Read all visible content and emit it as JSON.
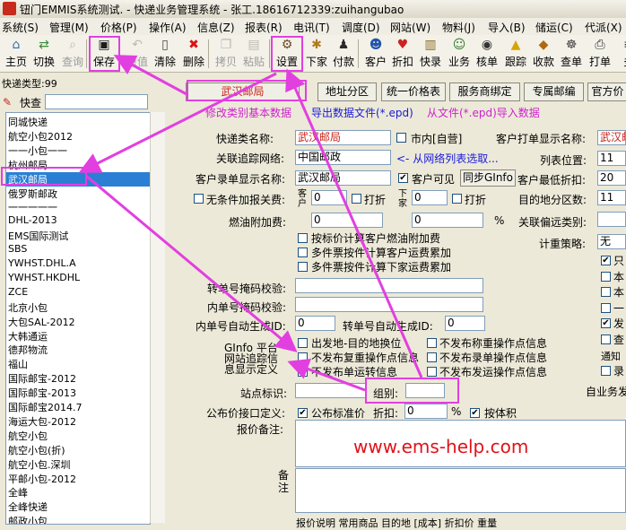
{
  "window": {
    "title": "钮门EMMIS系统测试. - 快递业务管理系统 - 张工.18616712339:zuihangubao"
  },
  "menu": [
    "系统(S)",
    "管理(M)",
    "价格(P)",
    "操作(A)",
    "信息(Z)",
    "报表(R)",
    "电讯(T)",
    "调度(D)",
    "网站(W)",
    "物料(J)",
    "导入(B)",
    "储运(C)",
    "代派(X)"
  ],
  "toolbar": [
    {
      "label": "主页",
      "icon": "home-icon",
      "glyph": "⌂",
      "color": "#2f6db5",
      "enabled": true
    },
    {
      "label": "切换",
      "icon": "switch-icon",
      "glyph": "⇄",
      "color": "#3c8a3c",
      "enabled": true
    },
    {
      "label": "查询",
      "icon": "query-icon",
      "glyph": "⌕",
      "color": "#777",
      "enabled": false
    },
    {
      "label": "保存",
      "icon": "save-icon",
      "glyph": "▣",
      "color": "#1c1c1c",
      "enabled": true
    },
    {
      "label": "原值",
      "icon": "restore-icon",
      "glyph": "↶",
      "color": "#777",
      "enabled": false
    },
    {
      "label": "清除",
      "icon": "clear-icon",
      "glyph": "▯",
      "color": "#444",
      "enabled": true
    },
    {
      "label": "删除",
      "icon": "delete-icon",
      "glyph": "✖",
      "color": "#d11",
      "enabled": true
    },
    {
      "label": "拷贝",
      "icon": "copy-icon",
      "glyph": "❐",
      "color": "#777",
      "enabled": false
    },
    {
      "label": "粘贴",
      "icon": "paste-icon",
      "glyph": "▤",
      "color": "#777",
      "enabled": false
    },
    {
      "label": "设置",
      "icon": "settings-icon",
      "glyph": "⚙",
      "color": "#6a4b2a",
      "enabled": true
    },
    {
      "label": "下家",
      "icon": "downstream-icon",
      "glyph": "✱",
      "color": "#b07a18",
      "enabled": true
    },
    {
      "label": "付款",
      "icon": "payment-icon",
      "glyph": "♟",
      "color": "#2a2a2a",
      "enabled": true
    },
    {
      "label": "客户",
      "icon": "customer-icon",
      "glyph": "☻",
      "color": "#2255aa",
      "enabled": true
    },
    {
      "label": "折扣",
      "icon": "discount-icon",
      "glyph": "♥",
      "color": "#cc2222",
      "enabled": true
    },
    {
      "label": "快录",
      "icon": "quick-entry-icon",
      "glyph": "▥",
      "color": "#8a6a20",
      "enabled": true
    },
    {
      "label": "业务",
      "icon": "business-icon",
      "glyph": "☺",
      "color": "#2a7a2a",
      "enabled": true
    },
    {
      "label": "核单",
      "icon": "check-order-icon",
      "glyph": "◉",
      "color": "#333",
      "enabled": true
    },
    {
      "label": "跟踪",
      "icon": "tracking-icon",
      "glyph": "▲",
      "color": "#d6a400",
      "enabled": true
    },
    {
      "label": "收款",
      "icon": "receive-icon",
      "glyph": "◆",
      "color": "#b06a10",
      "enabled": true
    },
    {
      "label": "查单",
      "icon": "search-order-icon",
      "glyph": "☸",
      "color": "#444",
      "enabled": true
    },
    {
      "label": "打单",
      "icon": "print-icon",
      "glyph": "⎙",
      "color": "#333",
      "enabled": true
    },
    {
      "label": "多",
      "icon": "more-icon",
      "glyph": "≡",
      "color": "#333",
      "enabled": true
    }
  ],
  "left": {
    "type_label": "快递类型:99",
    "search_label": "快查",
    "search_value": "",
    "items": [
      "同城快递",
      "航空小包2012",
      "一一小包一一",
      "杭州邮局",
      "武汉邮局",
      "俄罗斯邮政",
      "一一一一一",
      "DHL-2013",
      "EMS国际测试",
      "SBS",
      "YWHST.DHL.A",
      "YWHST.HKDHL",
      "ZCE",
      "北京小包",
      "大包SAL-2012",
      "大韩通运",
      "德邦物流",
      "福山",
      "国际邮宝-2012",
      "国际邮宝-2013",
      "国际邮宝2014.7",
      "海运大包-2012",
      "航空小包",
      "航空小包(折)",
      "航空小包.深圳",
      "平邮小包-2012",
      "全峰",
      "全峰快递",
      "邮政小包"
    ]
  },
  "tabs": [
    "武汉邮局",
    "地址分区",
    "统一价格表",
    "服务商绑定",
    "专属邮编",
    "官方价"
  ],
  "links": {
    "modify_basic": "修改类别基本数据",
    "export": "导出数据文件(*.epd)",
    "import": "从文件(*.epd)导入数据"
  },
  "form": {
    "type_name_label": "快递类名称:",
    "type_name_value": "武汉邮局",
    "city_label": "市内[自营]",
    "track_label": "关联追踪网络:",
    "track_value": "中国邮政",
    "track_hint": "<- 从网络列表选取...",
    "display_label": "客户录单显示名称:",
    "display_value": "武汉邮局",
    "visible_label": "客户可见",
    "sync_label": "同步GInfo",
    "no_extra_label": "无条件加报关费:",
    "customer_vert": "客户",
    "downstream_vert": "下家",
    "extra1": "0",
    "extra2": "0",
    "discount_label": "打折",
    "fuel_label": "燃油附加费:",
    "fuel_c": "0",
    "fuel_d": "0",
    "percent": "%",
    "opt1": "按标价计算客户燃油附加费",
    "opt2": "多件票按件计算客户运费累加",
    "opt3": "多件票按件计算下家运费累加",
    "waybill_mask_label": "转单号掩码校验:",
    "inner_mask_label": "内单号掩码校验:",
    "auto_id_label": "内单号自动生成ID:",
    "auto_id_value": "0",
    "trans_id_label": "转单号自动生成ID:",
    "trans_id_value": "0",
    "ginfo_platform": "GInfo 平台",
    "site_tracking": "网站追踪信",
    "info_defined": "息显示定义",
    "o1": "出发地-目的地换位",
    "o2": "不发布称重操作点信息",
    "o3": "不发布复重操作点信息",
    "o4": "不发布录单操作点信息",
    "o5": "不发布单运转信息",
    "o6": "不发布发运操作点信息",
    "station_label": "站点标识:",
    "group_label": "组别:",
    "public_label": "公布价接口定义:",
    "public_std": "公布标准价",
    "discount2_label": "折扣:",
    "discount2_value": "0",
    "volume_label": "按体积",
    "remark_label": "报价备注:",
    "note_label": "备注",
    "bottom_text": "报价说明  常用商品  目的地 [成本]  折扣价  重量"
  },
  "right": {
    "print_name_label": "客户打单显示名称:",
    "print_name_value": "武汉邮",
    "list_pos_label": "列表位置:",
    "list_pos_value": "11",
    "min_disc_label": "客户最低折扣:",
    "min_disc_value": "20",
    "zone_count_label": "目的地分区数:",
    "zone_count_value": "11",
    "pref_label": "关联偏远类别:",
    "weight_policy_label": "计重策略:",
    "weight_policy_value": "无",
    "side_opts": [
      "只",
      "本",
      "本",
      "一",
      "发",
      "查"
    ],
    "notify": "通知",
    "record": "录",
    "auto_service": "自业务发"
  },
  "watermark": "www.ems-help.com",
  "colors": {
    "accent": "#e23fe0",
    "link_blue": "#1a1ad8",
    "link_magenta": "#d020d0",
    "selected": "#2a7fd4",
    "watermark_red": "#e0121a"
  }
}
